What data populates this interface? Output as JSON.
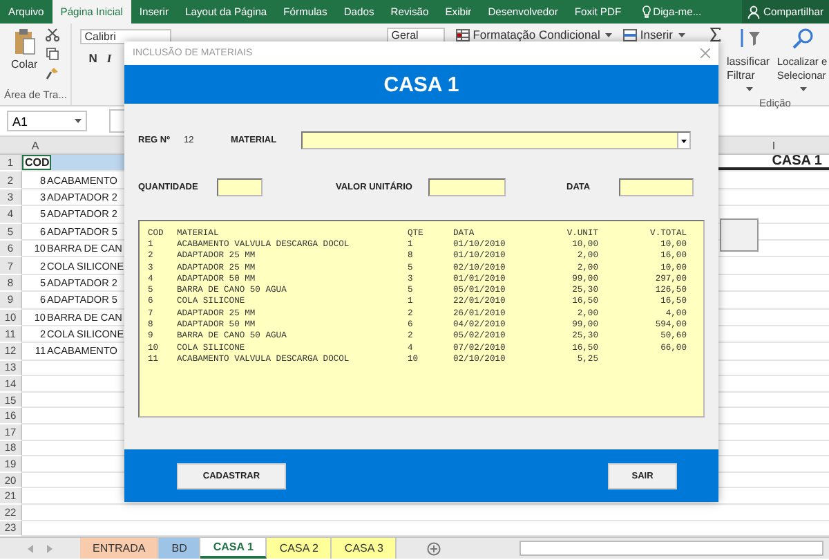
{
  "ribbon_tabs": [
    {
      "label": "Arquivo",
      "selected": false
    },
    {
      "label": "Página Inicial",
      "selected": true
    },
    {
      "label": "Inserir",
      "selected": false
    },
    {
      "label": "Layout da Página",
      "selected": false
    },
    {
      "label": "Fórmulas",
      "selected": false
    },
    {
      "label": "Dados",
      "selected": false
    },
    {
      "label": "Revisão",
      "selected": false
    },
    {
      "label": "Exibir",
      "selected": false
    },
    {
      "label": "Desenvolvedor",
      "selected": false
    },
    {
      "label": "Foxit PDF",
      "selected": false
    }
  ],
  "tell_me": "Diga-me...",
  "share": "Compartilhar",
  "ribbon": {
    "paste": "Colar",
    "font": "Calibri",
    "bold": "N",
    "italic": "I",
    "clipboard_group": "Área de Tra...",
    "number_format": "Geral",
    "conditional_formatting": "Formatação Condicional",
    "insert": "Inserir",
    "sort_line_1": "lassificar",
    "sort_line_2": "Filtrar",
    "find_line_1": "Localizar e",
    "find_line_2": "Selecionar",
    "editing_group": "Edição"
  },
  "name_box": "A1",
  "columns": [
    "A",
    "I"
  ],
  "row_numbers": [
    "1",
    "2",
    "3",
    "4",
    "5",
    "6",
    "7",
    "8",
    "9",
    "10",
    "11",
    "12",
    "13",
    "14",
    "15",
    "16",
    "17",
    "18",
    "19",
    "20",
    "21",
    "22",
    "23"
  ],
  "header_cell": "COD",
  "title_cell": "CASA 1",
  "sheet_rows": [
    {
      "code": "8",
      "material": "ACABAMENTO"
    },
    {
      "code": "3",
      "material": "ADAPTADOR 2"
    },
    {
      "code": "5",
      "material": "ADAPTADOR 2"
    },
    {
      "code": "6",
      "material": "ADAPTADOR 5"
    },
    {
      "code": "10",
      "material": "BARRA DE CAN"
    },
    {
      "code": "2",
      "material": "COLA SILICONE"
    },
    {
      "code": "5",
      "material": "ADAPTADOR 2"
    },
    {
      "code": "6",
      "material": "ADAPTADOR 5"
    },
    {
      "code": "10",
      "material": "BARRA DE CAN"
    },
    {
      "code": "2",
      "material": "COLA SILICONE"
    },
    {
      "code": "11",
      "material": "ACABAMENTO"
    }
  ],
  "sheet_tabs": [
    {
      "label": "ENTRADA",
      "color": "#f8cbad",
      "selected": false
    },
    {
      "label": "BD",
      "color": "#9dc3e6",
      "selected": false
    },
    {
      "label": "CASA 1",
      "color": "#ffffff",
      "selected": true
    },
    {
      "label": "CASA 2",
      "color": "#ffff99",
      "selected": false
    },
    {
      "label": "CASA 3",
      "color": "#ffff99",
      "selected": false
    }
  ],
  "dialog": {
    "title": "INCLUSÃO DE MATERIAIS",
    "heading": "CASA 1",
    "reg_label": "REG Nº",
    "reg_value": "12",
    "material_label": "MATERIAL",
    "quantity_label": "QUANTIDADE",
    "unit_value_label": "VALOR UNITÁRIO",
    "date_label": "DATA",
    "list_columns": [
      "COD",
      "MATERIAL",
      "QTE",
      "DATA",
      "V.UNIT",
      "V.TOTAL"
    ],
    "list_rows": [
      [
        "1",
        "ACABAMENTO VALVULA DESCARGA DOCOL",
        "1",
        "01/10/2010",
        "10,00",
        "10,00"
      ],
      [
        "2",
        "ADAPTADOR 25 MM",
        "8",
        "01/10/2010",
        "2,00",
        "16,00"
      ],
      [
        "3",
        "ADAPTADOR 25 MM",
        "5",
        "02/10/2010",
        "2,00",
        "10,00"
      ],
      [
        "4",
        "ADAPTADOR 50 MM",
        "3",
        "01/01/2010",
        "99,00",
        "297,00"
      ],
      [
        "5",
        "BARRA DE CANO 50 AGUA",
        "5",
        "05/01/2010",
        "25,30",
        "126,50"
      ],
      [
        "6",
        "COLA SILICONE",
        "1",
        "22/01/2010",
        "16,50",
        "16,50"
      ],
      [
        "7",
        "ADAPTADOR 25 MM",
        "2",
        "26/01/2010",
        "2,00",
        "4,00"
      ],
      [
        "8",
        "ADAPTADOR 50 MM",
        "6",
        "04/02/2010",
        "99,00",
        "594,00"
      ],
      [
        "9",
        "BARRA DE CANO 50 AGUA",
        "2",
        "05/02/2010",
        "25,30",
        "50,60"
      ],
      [
        "10",
        "COLA SILICONE",
        "4",
        "07/02/2010",
        "16,50",
        "66,00"
      ],
      [
        "11",
        "ACABAMENTO VALVULA DESCARGA DOCOL",
        "10",
        "02/10/2010",
        "5,25",
        ""
      ]
    ],
    "buttons": [
      "CADASTRAR",
      "SAIR"
    ]
  }
}
